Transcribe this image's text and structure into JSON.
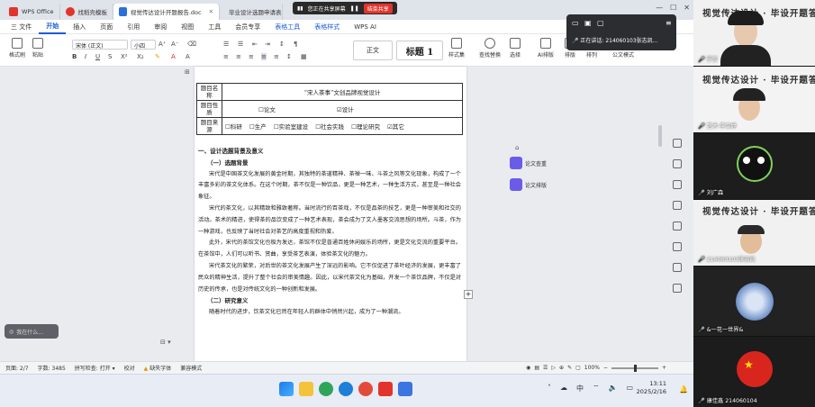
{
  "tabs": [
    {
      "label": "WPS Office",
      "color": "#e1342c"
    },
    {
      "label": "找稻壳模板",
      "color": "#e1342c"
    },
    {
      "label": "视觉传达设计开题报告.doc",
      "color": "#2b6fdb"
    },
    {
      "label": "毕业设计选题申请表.doc",
      "color": "#2b6fdb"
    }
  ],
  "share": {
    "text": "您正在共享屏幕",
    "stop": "结束共享"
  },
  "menu": {
    "file": "三 文件",
    "items": [
      "开始",
      "插入",
      "页面",
      "引用",
      "审阅",
      "视图",
      "工具",
      "会员专享",
      "表格工具",
      "表格样式",
      "WPS AI"
    ]
  },
  "ribbon": {
    "format_painter": "格式刷",
    "paste": "粘贴",
    "font_name": "宋体 (正文)",
    "font_size": "小四",
    "style_normal": "正文",
    "style_heading": "标题 1",
    "style_set": "样式集",
    "find_replace": "查找替换",
    "select": "选择",
    "ai_layout": "AI排版",
    "layout": "排版",
    "arrange": "排列",
    "doc_mode": "公文模式"
  },
  "meeting_panel": {
    "speaker": "正在讲话: 214060103张志凯..."
  },
  "table": {
    "row1_label": "题目名称",
    "row1_value": "“宋人茶事”文创品牌视觉设计",
    "row2_label": "题目性质",
    "row2_options": [
      "☐论文",
      "☑设计"
    ],
    "row3_label": "题目来源",
    "row3_options": [
      "☐科研",
      "☐生产",
      "☐实验室建设",
      "☐社会实践",
      "☐理论研究",
      "☑其它"
    ]
  },
  "body": {
    "h1": "一、设计选题背景及意义",
    "h2": "（一）选题背景",
    "p1": "宋代是中国茶文化发展的黄金时期，其独特的茶道精神、茶禅一味、斗茶之风等文化现象，构成了一个丰富多彩的茶文化体系。在这个时期，茶不仅是一种饮品，更是一种艺术，一种生活方式，甚至是一种社会象征。",
    "p2": "宋代的茶文化，以其精致和雅致著称。当时流行的百茶戏，不仅是品茶的技艺，更是一种审美和社交的活动。茶术的精进，使得茶的品饮变成了一种艺术表现，茶会成为了文人墨客交流思想的场所。斗茶，作为一种游戏，也反映了当时社会对茶艺的高度重视和热爱。",
    "p3": "此外，宋代的茶馆文化也极为发达，茶馆不仅是普通百姓休闲娱乐的场所，更是文化交流的重要平台。在茶馆中，人们可以听书、赏曲，享受茶艺表演，体验茶文化的魅力。",
    "p4": "宋代茶文化的繁荣，对后世的茶文化发展产生了深远的影响。它不仅促进了茶叶经济的发展，更丰富了民众的精神生活，提升了整个社会的审美情趣。因此，以宋代茶文化为基础，开发一个茶饮品牌，不仅是对历史的传承，也是对传统文化的一种创新和发展。",
    "h3": "（二）研究意义",
    "p5": "随着时代的进步，饮茶文化已然在年轻人的群体中悄然兴起，成为了一种潮流。"
  },
  "side_tools": {
    "btn1": "论文查重",
    "btn2": "论文排版"
  },
  "ai_bubble": "我在什么...",
  "status": {
    "page": "页面: 2/7",
    "words": "字数: 3485",
    "spell": "拼写检查: 打开 ▾",
    "proof": "校对",
    "missing_font": "缺失字体",
    "compat": "兼容模式",
    "zoom": "100%"
  },
  "clock": {
    "time": "13:11",
    "date": "2025/2/16"
  },
  "participants": [
    {
      "name": "罗莎",
      "banner": "视觉传达设计 · 毕设开题答辩"
    },
    {
      "name": "艺术-李文婷",
      "banner": "视觉传达设计 · 毕设开题答辩"
    },
    {
      "name": "刘广森",
      "banner": ""
    },
    {
      "name": "214060103张志凯",
      "banner": "视觉传达设计 · 毕设开题答辩"
    },
    {
      "name": "&一花一世界&",
      "banner": ""
    },
    {
      "name": "康佳鑫 214060104",
      "banner": ""
    }
  ]
}
